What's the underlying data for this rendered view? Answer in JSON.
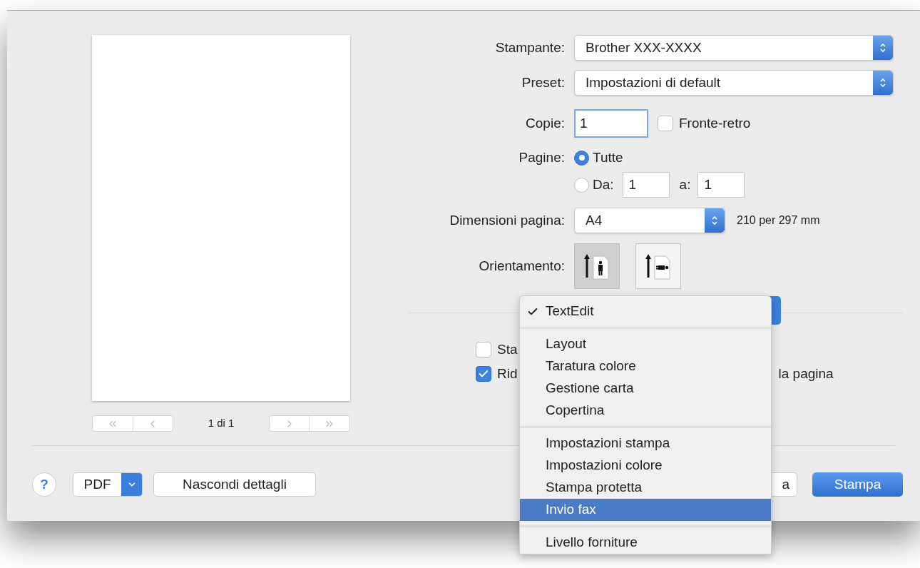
{
  "preview": {
    "page_label": "1 di 1"
  },
  "form": {
    "printer": {
      "label": "Stampante:",
      "value": "Brother XXX-XXXX"
    },
    "preset": {
      "label": "Preset:",
      "value": "Impostazioni di default"
    },
    "copies": {
      "label": "Copie:",
      "value": "1"
    },
    "duplex": {
      "label": "Fronte-retro",
      "checked": false
    },
    "pages": {
      "label": "Pagine:",
      "options": [
        {
          "label": "Tutte",
          "selected": true
        },
        {
          "label": "Da:",
          "selected": false
        }
      ],
      "from": "1",
      "to_label": "a:",
      "to": "1"
    },
    "paper_size": {
      "label": "Dimensioni pagina:",
      "value": "A4",
      "dimensions": "210 per 297 mm"
    },
    "orientation": {
      "label": "Orientamento:",
      "options": [
        {
          "kind": "portrait",
          "selected": true
        },
        {
          "kind": "landscape",
          "selected": false
        }
      ]
    }
  },
  "options": [
    {
      "label": "Sta",
      "checked": false
    },
    {
      "label": "Rid",
      "checked": true,
      "trailing": "la pagina"
    }
  ],
  "bottom": {
    "help": "?",
    "pdf": "PDF",
    "details": "Nascondi dettagli",
    "cancel_fragment": "a",
    "print": "Stampa"
  },
  "menu": {
    "groups": [
      {
        "items": [
          {
            "label": "TextEdit",
            "checked": true,
            "selected": false
          }
        ]
      },
      {
        "items": [
          {
            "label": "Layout",
            "checked": false,
            "selected": false
          },
          {
            "label": "Taratura colore",
            "checked": false,
            "selected": false
          },
          {
            "label": "Gestione carta",
            "checked": false,
            "selected": false
          },
          {
            "label": "Copertina",
            "checked": false,
            "selected": false
          }
        ]
      },
      {
        "items": [
          {
            "label": "Impostazioni stampa",
            "checked": false,
            "selected": false
          },
          {
            "label": "Impostazioni colore",
            "checked": false,
            "selected": false
          },
          {
            "label": "Stampa protetta",
            "checked": false,
            "selected": false
          },
          {
            "label": "Invio fax",
            "checked": false,
            "selected": true
          }
        ]
      },
      {
        "items": [
          {
            "label": "Livello forniture",
            "checked": false,
            "selected": false
          }
        ]
      }
    ]
  }
}
